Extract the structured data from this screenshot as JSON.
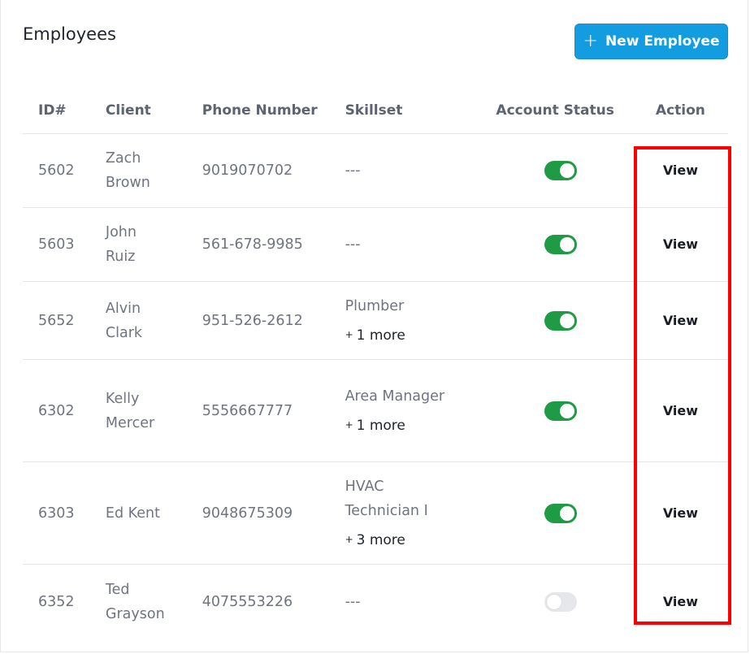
{
  "header": {
    "title": "Employees",
    "new_button_icon": "plus-icon",
    "new_button_label": "New Employee",
    "accent_color": "#139de0"
  },
  "table": {
    "columns": [
      "ID#",
      "Client",
      "Phone Number",
      "Skillset",
      "Account Status",
      "Action"
    ],
    "rows": [
      {
        "id": "5602",
        "client": "Zach Brown",
        "phone": "9019070702",
        "skillset": "---",
        "skill_more": "",
        "status_on": true,
        "action": "View"
      },
      {
        "id": "5603",
        "client": "John Ruiz",
        "phone": "561-678-9985",
        "skillset": "---",
        "skill_more": "",
        "status_on": true,
        "action": "View"
      },
      {
        "id": "5652",
        "client": "Alvin Clark",
        "phone": "951-526-2612",
        "skillset": "Plumber",
        "skill_more": "1 more",
        "status_on": true,
        "action": "View"
      },
      {
        "id": "6302",
        "client": "Kelly Mercer",
        "phone": "5556667777",
        "skillset": "Area Manager",
        "skill_more": "1 more",
        "status_on": true,
        "action": "View"
      },
      {
        "id": "6303",
        "client": "Ed Kent",
        "phone": "9048675309",
        "skillset": "HVAC Technician I",
        "skill_more": "3 more",
        "status_on": true,
        "action": "View"
      },
      {
        "id": "6352",
        "client": "Ted Grayson",
        "phone": "4075553226",
        "skillset": "---",
        "skill_more": "",
        "status_on": false,
        "action": "View"
      }
    ]
  },
  "colors": {
    "toggle_on": "#1e9b44",
    "toggle_off": "#e6e7ea",
    "highlight": "#ff0000"
  }
}
